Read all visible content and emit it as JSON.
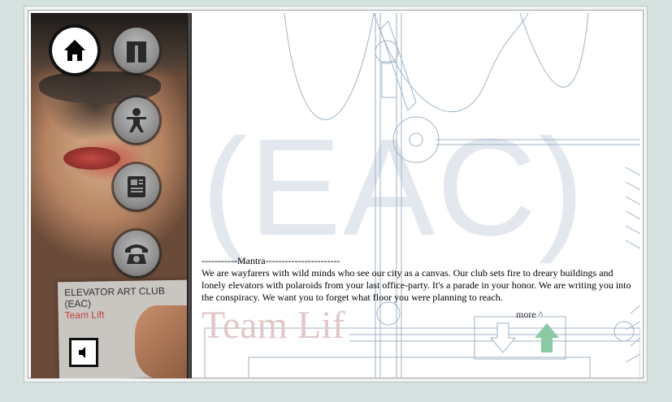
{
  "sidebar": {
    "nav": [
      {
        "icon": "home-icon",
        "active": true
      },
      {
        "icon": "gift-icon",
        "active": false
      },
      {
        "icon": "person-icon",
        "active": false
      },
      {
        "icon": "newspaper-icon",
        "active": false
      },
      {
        "icon": "telephone-icon",
        "active": false
      }
    ],
    "card": {
      "line1": "ELEVATOR ART CLUB",
      "line2": "(EAC)",
      "line3": "Team Lift"
    },
    "sound_icon": "speaker-icon"
  },
  "main": {
    "watermark": "(EAC)",
    "team_ghost": "Team Lif",
    "mantra_heading": "-----------Mantra-----------------------",
    "mantra_body": "We are wayfarers with wild minds who see our city as a canvas. Our club sets fire to dreary buildings and lonely elevators with polaroids from your last office-party. It's a parade in your honor. We are writing you into the conspiracy. We want you to forget what floor you were planning to reach.",
    "more_label": "more",
    "scroll_down_icon": "arrow-down-icon",
    "scroll_up_icon": "arrow-up-icon"
  },
  "colors": {
    "background": "#d6e2df",
    "watermark": "#e3e8ee",
    "team_ghost": "#e2c7c9",
    "up_arrow": "#8ac9a3",
    "card_red": "#c0423d"
  }
}
